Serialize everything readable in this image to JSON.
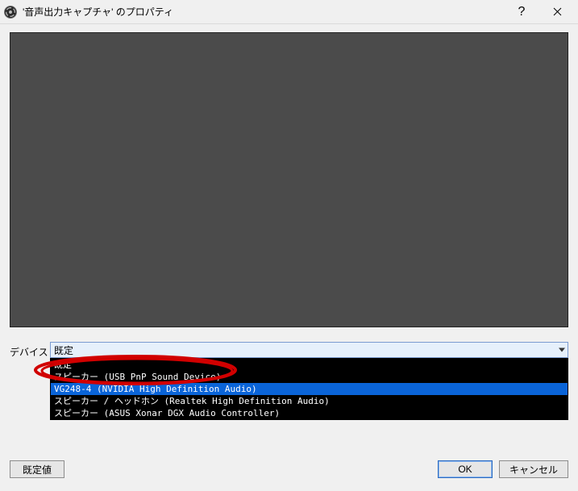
{
  "titlebar": {
    "title": "'音声出力キャプチャ' のプロパティ"
  },
  "device": {
    "label": "デバイス",
    "selected": "既定",
    "options": [
      "既定",
      "スピーカー (USB PnP Sound Device)",
      "VG248-4 (NVIDIA High Definition Audio)",
      "スピーカー / ヘッドホン (Realtek High Definition Audio)",
      "スピーカー (ASUS Xonar DGX Audio Controller)"
    ],
    "highlighted_index": 2
  },
  "buttons": {
    "defaults": "既定値",
    "ok": "OK",
    "cancel": "キャンセル"
  },
  "icons": {
    "app": "obs-icon",
    "help": "?",
    "close": "close"
  }
}
